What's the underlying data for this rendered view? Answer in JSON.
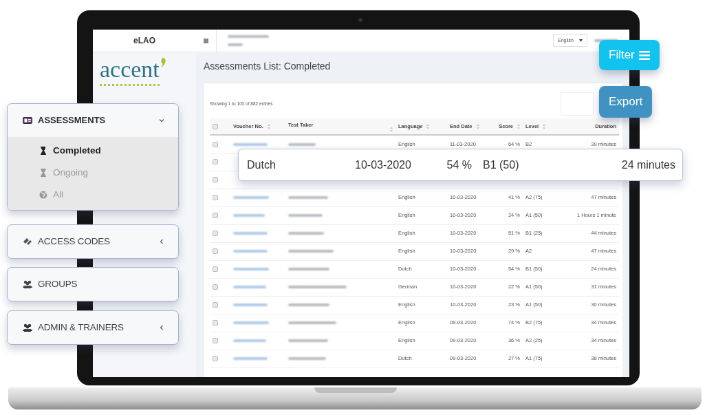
{
  "sidebar": {
    "app_title": "eLAO",
    "logo_text": "accent"
  },
  "topbar": {
    "language_select": "English"
  },
  "page_title": "Assessments List: Completed",
  "table": {
    "info": "Showing 1 to 100 of 882 entries",
    "columns": [
      {
        "kind": "checkbox",
        "checked": false
      },
      {
        "kind": "text",
        "label": "Voucher No.",
        "sortable": true
      },
      {
        "kind": "text",
        "label": "Test Taker",
        "sortable": true
      },
      {
        "kind": "text",
        "label": "Language",
        "sortable": true
      },
      {
        "kind": "text",
        "label": "End Date",
        "sortable": true
      },
      {
        "kind": "num",
        "label": "Score",
        "sortable": true
      },
      {
        "kind": "text",
        "label": "Level",
        "sortable": true
      },
      {
        "kind": "num",
        "label": "Duration",
        "sortable": false
      }
    ],
    "rows": [
      {
        "checked": false,
        "language": "English",
        "end_date": "11-03-2020",
        "score": "64 %",
        "level": "B2",
        "duration": "39 minutes"
      },
      {
        "checked": false
      },
      {
        "checked": false
      },
      {
        "checked": false,
        "language": "English",
        "end_date": "10-03-2020",
        "score": "41 %",
        "level": "A2 (75)",
        "duration": "47 minutes"
      },
      {
        "checked": false,
        "language": "English",
        "end_date": "10-03-2020",
        "score": "24 %",
        "level": "A1 (50)",
        "duration": "1 Hours 1 minute"
      },
      {
        "checked": false,
        "language": "English",
        "end_date": "10-03-2020",
        "score": "51 %",
        "level": "B1 (25)",
        "duration": "44 minutes"
      },
      {
        "checked": false,
        "language": "English",
        "end_date": "10-03-2020",
        "score": "29 %",
        "level": "A2",
        "duration": "47 minutes"
      },
      {
        "checked": false,
        "language": "Dutch",
        "end_date": "10-03-2020",
        "score": "54 %",
        "level": "B1 (50)",
        "duration": "24 minutes"
      },
      {
        "checked": false,
        "language": "German",
        "end_date": "10-03-2020",
        "score": "22 %",
        "level": "A1 (50)",
        "duration": "31 minutes"
      },
      {
        "checked": false,
        "language": "English",
        "end_date": "10-03-2020",
        "score": "23 %",
        "level": "A1 (50)",
        "duration": "30 minutes"
      },
      {
        "checked": false,
        "language": "English",
        "end_date": "09-03-2020",
        "score": "74 %",
        "level": "B2 (75)",
        "duration": "34 minutes"
      },
      {
        "checked": false,
        "language": "English",
        "end_date": "09-03-2020",
        "score": "36 %",
        "level": "A2 (25)",
        "duration": "34 minutes"
      },
      {
        "checked": false,
        "language": "Dutch",
        "end_date": "09-03-2020",
        "score": "27 %",
        "level": "A1 (75)",
        "duration": "38 minutes"
      }
    ]
  },
  "highlight_row": {
    "language": "Dutch",
    "end_date": "10-03-2020",
    "score": "54 %",
    "level": "B1 (50)",
    "duration": "24 minutes"
  },
  "menu": [
    {
      "label": "ASSESSMENTS",
      "kind": "expandable",
      "expanded": true,
      "children": [
        {
          "label": "Completed",
          "selected": true
        },
        {
          "label": "Ongoing",
          "selected": false
        },
        {
          "label": "All",
          "selected": false
        }
      ]
    },
    {
      "label": "ACCESS CODES",
      "kind": "expandable",
      "expanded": false
    },
    {
      "label": "GROUPS",
      "kind": "link"
    },
    {
      "label": "ADMIN & TRAINERS",
      "kind": "expandable",
      "expanded": false
    }
  ],
  "actions": [
    {
      "label": "Filter",
      "kind": "filter"
    },
    {
      "label": "Export",
      "kind": "export"
    }
  ]
}
